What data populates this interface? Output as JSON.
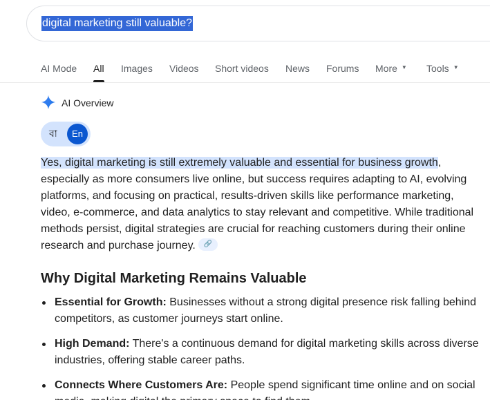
{
  "search": {
    "query": "digital marketing still valuable?"
  },
  "tabs": [
    {
      "label": "AI Mode"
    },
    {
      "label": "All"
    },
    {
      "label": "Images"
    },
    {
      "label": "Videos"
    },
    {
      "label": "Short videos"
    },
    {
      "label": "News"
    },
    {
      "label": "Forums"
    },
    {
      "label": "More"
    },
    {
      "label": "Tools"
    }
  ],
  "active_tab": "All",
  "ai_overview": {
    "title": "AI Overview",
    "lang_bn": "বা",
    "lang_en": "En",
    "highlight": "Yes, digital marketing is still extremely valuable and essential for business growth",
    "body": ", especially as more consumers live online, but success requires adapting to AI, evolving platforms, and focusing on practical, results-driven skills like performance marketing, video, e-commerce, and data analytics to stay relevant and competitive. While traditional methods persist, digital strategies are crucial for reaching customers during their online research and purchase journey.",
    "section_heading": "Why Digital Marketing Remains Valuable",
    "bullets": [
      {
        "title": "Essential for Growth:",
        "text": " Businesses without a strong digital presence risk falling behind competitors, as customer journeys start online."
      },
      {
        "title": "High Demand:",
        "text": " There's a continuous demand for digital marketing skills across diverse industries, offering stable career paths."
      },
      {
        "title": "Connects Where Customers Are:",
        "text": " People spend significant time online and on social media, making digital the primary space to find them."
      }
    ]
  },
  "colors": {
    "highlight": "#d3e3fd",
    "accent": "#0b57d0",
    "selection": "#3367d6"
  }
}
